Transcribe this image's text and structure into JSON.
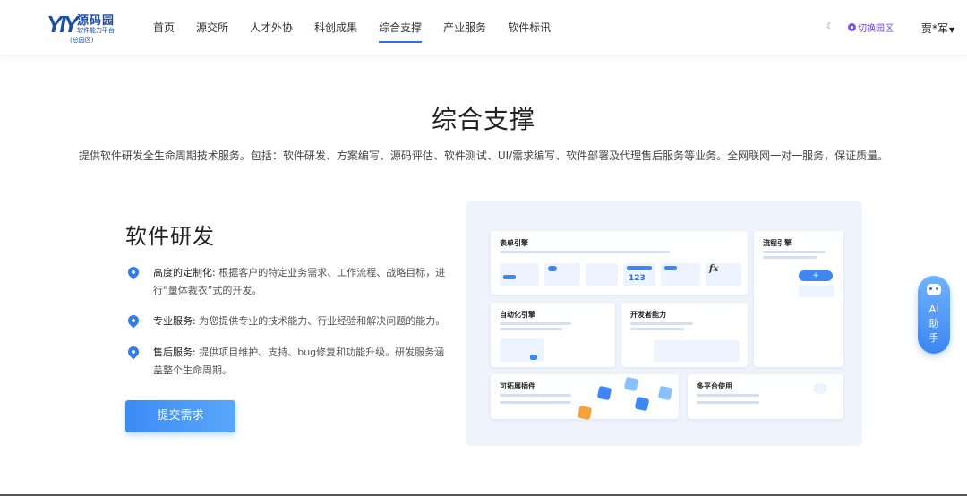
{
  "header": {
    "logo": {
      "mark": "YIY",
      "name": "源码园",
      "subtitle": "软件能力平台",
      "region": "(总园区)"
    },
    "nav": [
      {
        "label": "首页",
        "active": false
      },
      {
        "label": "源交所",
        "active": false
      },
      {
        "label": "人才外协",
        "active": false
      },
      {
        "label": "科创成果",
        "active": false
      },
      {
        "label": "综合支撑",
        "active": true
      },
      {
        "label": "产业服务",
        "active": false
      },
      {
        "label": "软件标讯",
        "active": false
      }
    ],
    "theme_icon": "moon-icon",
    "switch_park": "切换园区",
    "user": "贾*军"
  },
  "hero": {
    "title": "综合支撑",
    "description": "提供软件研发全生命周期技术服务。包括：软件研发、方案编写、源码评估、软件测试、UI/需求编写、软件部署及代理售后服务等业务。全网联网一对一服务，保证质量。"
  },
  "section": {
    "title": "软件研发",
    "features": [
      {
        "head": "高度的定制化:",
        "body": " 根据客户的特定业务需求、工作流程、战略目标，进行“量体裁衣”式的开发。"
      },
      {
        "head": "专业服务:",
        "body": " 为您提供专业的技术能力、行业经验和解决问题的能力。"
      },
      {
        "head": "售后服务:",
        "body": " 提供项目维护、支持、bug修复和功能升级。研发服务涵盖整个生命周期。"
      }
    ],
    "submit": "提交需求"
  },
  "illustration": {
    "cards": {
      "form_engine": "表单引擎",
      "flow_engine": "流程引擎",
      "automation": "自动化引擎",
      "developer": "开发者能力",
      "plugins": "可拓展插件",
      "multiplatform": "多平台使用"
    },
    "form_value": "123",
    "fx": "fx"
  },
  "ai_float": {
    "label_line1": "AI",
    "label_line2": "助",
    "label_line3": "手"
  },
  "colors": {
    "accent": "#2f6fde",
    "button": "#3b8bf5",
    "switch": "#6a45d8",
    "panel_bg": "#eef3fc"
  }
}
